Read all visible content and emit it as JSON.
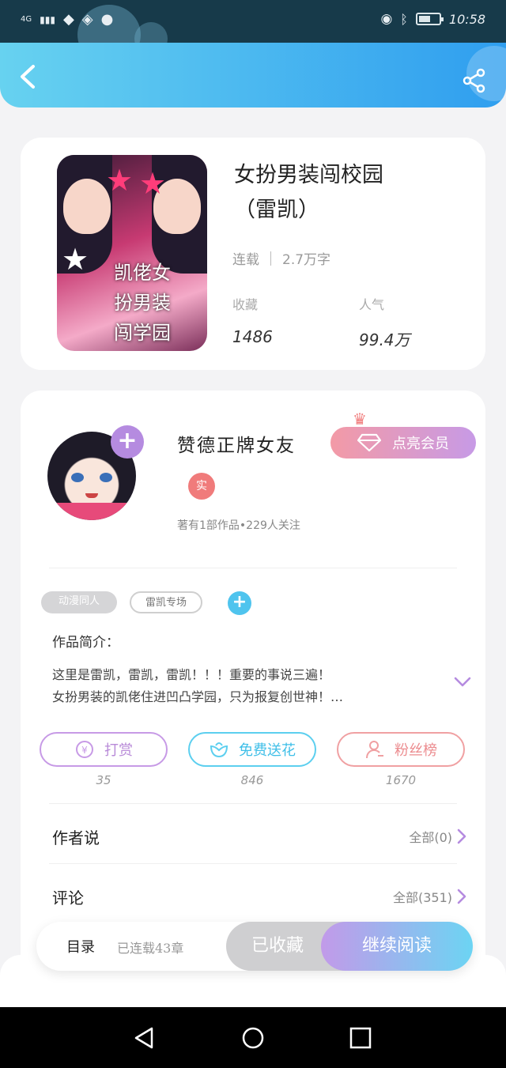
{
  "status_bar": {
    "network": "4G",
    "time": "10:58",
    "battery_level": 0.6
  },
  "book": {
    "title_line1": "女扮男装闯校园",
    "title_line2": "（雷凯）",
    "status": "连载",
    "word_count": "2.7万字",
    "collect_label": "收藏",
    "collect_value": "1486",
    "popularity_label": "人气",
    "popularity_value": "99.4万",
    "cover_text": [
      "凯佬女",
      "扮男装",
      "闯学园"
    ]
  },
  "author": {
    "name": "赞德正牌女友",
    "real_badge": "实",
    "meta": "著有1部作品•229人关注",
    "vip_label": "点亮会员"
  },
  "tags": [
    "动漫同人",
    "雷凯专场"
  ],
  "intro": {
    "label": "作品简介：",
    "line1": "这里是雷凯，雷凯，雷凯！！！重要的事说三遍！",
    "line2": "女扮男装的凯佬住进凹凸学园，只为报复创世神！…"
  },
  "actions": [
    {
      "label": "打赏",
      "count": "35"
    },
    {
      "label": "免费送花",
      "count": "846"
    },
    {
      "label": "粉丝榜",
      "count": "1670"
    }
  ],
  "rows": {
    "author_say": {
      "title": "作者说",
      "link": "全部(0)"
    },
    "comments": {
      "title": "评论",
      "link": "全部(351)"
    }
  },
  "bottom": {
    "toc": "目录",
    "chapters": "已连载43章",
    "collected": "已收藏",
    "continue": "继续阅读"
  },
  "colors": {
    "header_start": "#67d2f0",
    "header_end": "#2f9eef",
    "accent_purple": "#c79ae6",
    "accent_blue": "#5ccfef",
    "accent_pink": "#f0a0a2"
  }
}
